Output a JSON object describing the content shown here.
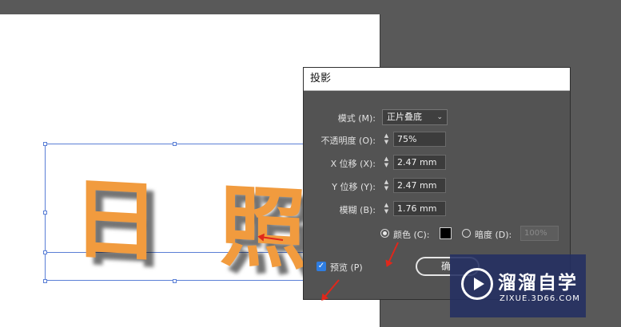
{
  "artboard": {
    "text": "日 照"
  },
  "dialog": {
    "title": "投影",
    "mode": {
      "label": "模式 (M):",
      "value": "正片叠底"
    },
    "opacity": {
      "label": "不透明度 (O):",
      "value": "75%"
    },
    "x_offset": {
      "label": "X 位移 (X):",
      "value": "2.47 mm"
    },
    "y_offset": {
      "label": "Y 位移 (Y):",
      "value": "2.47 mm"
    },
    "blur": {
      "label": "模糊 (B):",
      "value": "1.76 mm"
    },
    "color_option": {
      "label": "颜色 (C):",
      "selected": true,
      "swatch": "#000000"
    },
    "darkness_option": {
      "label": "暗度 (D):",
      "value": "100%",
      "disabled": true
    },
    "preview": {
      "label": "预览 (P)",
      "checked": true
    },
    "ok_label": "确"
  },
  "watermark": {
    "title": "溜溜自学",
    "url": "ZIXUE.3D66.COM"
  },
  "colors": {
    "accent_orange": "#f19b3e",
    "annotation_red": "#e0271b",
    "checkbox_blue": "#2e7de1"
  }
}
